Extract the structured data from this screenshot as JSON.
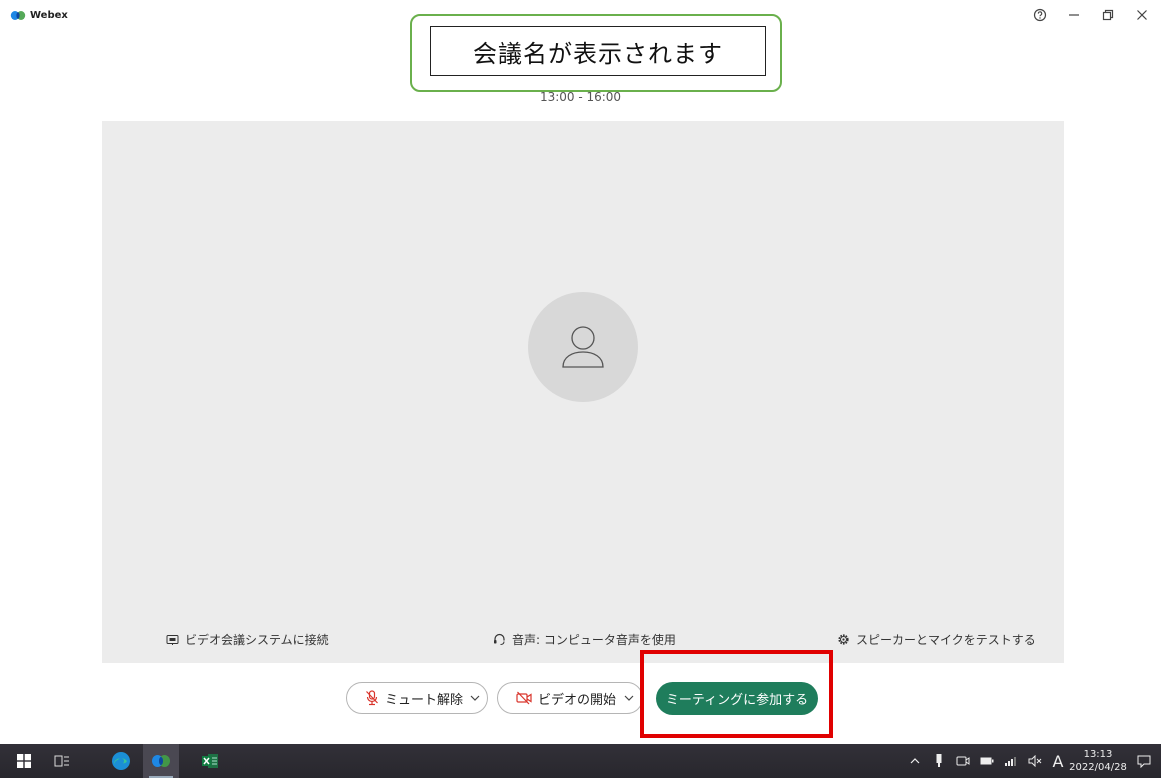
{
  "app": {
    "name": "Webex"
  },
  "meeting": {
    "title_placeholder": "会議名が表示されます",
    "time": "13:00 - 16:00"
  },
  "options": {
    "video_system": "ビデオ会議システムに接続",
    "audio": "音声: コンピュータ音声を使用",
    "test": "スピーカーとマイクをテストする"
  },
  "controls": {
    "mute_label": "ミュート解除",
    "video_label": "ビデオの開始",
    "join_label": "ミーティングに参加する"
  },
  "taskbar": {
    "ime": "A",
    "time": "13:13",
    "date": "2022/04/28"
  },
  "colors": {
    "join_button": "#1f7d5c",
    "highlight": "#e00000",
    "callout_border": "#6ab04c",
    "preview_bg": "#ececec",
    "mute_icon": "#d9342b"
  }
}
